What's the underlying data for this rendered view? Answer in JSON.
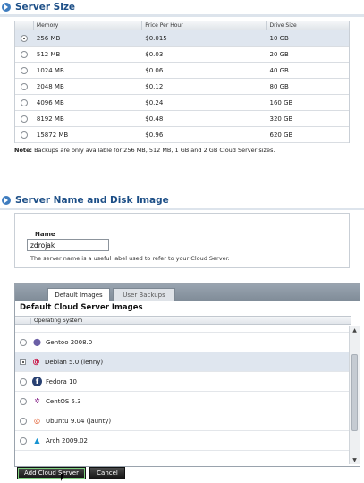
{
  "server_size": {
    "title": "Server Size",
    "headers": {
      "memory": "Memory",
      "price": "Price Per Hour",
      "disk": "Drive Size"
    },
    "rows": [
      {
        "memory": "256 MB",
        "price": "$0.015",
        "disk": "10 GB",
        "selected": true
      },
      {
        "memory": "512 MB",
        "price": "$0.03",
        "disk": "20 GB",
        "selected": false
      },
      {
        "memory": "1024 MB",
        "price": "$0.06",
        "disk": "40 GB",
        "selected": false
      },
      {
        "memory": "2048 MB",
        "price": "$0.12",
        "disk": "80 GB",
        "selected": false
      },
      {
        "memory": "4096 MB",
        "price": "$0.24",
        "disk": "160 GB",
        "selected": false
      },
      {
        "memory": "8192 MB",
        "price": "$0.48",
        "disk": "320 GB",
        "selected": false
      },
      {
        "memory": "15872 MB",
        "price": "$0.96",
        "disk": "620 GB",
        "selected": false
      }
    ],
    "note_label": "Note:",
    "note_text": " Backups are only available for 256 MB, 512 MB, 1 GB and 2 GB Cloud Server sizes."
  },
  "name_section": {
    "title": "Server Name and Disk Image",
    "name_label": "Name",
    "name_value": "zdrojak",
    "name_help": "The server name is a useful label used to refer to your Cloud Server."
  },
  "images": {
    "tabs": {
      "default": "Default Images",
      "backups": "User Backups"
    },
    "panel_title": "Default Cloud Server Images",
    "column_header": "Operating System",
    "items": [
      {
        "label": "Gentoo 2008.0",
        "icon": "gentoo-icon",
        "selected": false
      },
      {
        "label": "Debian 5.0 (lenny)",
        "icon": "debian-icon",
        "selected": true
      },
      {
        "label": "Fedora 10",
        "icon": "fedora-icon",
        "selected": false
      },
      {
        "label": "CentOS 5.3",
        "icon": "centos-icon",
        "selected": false
      },
      {
        "label": "Ubuntu 9.04 (jaunty)",
        "icon": "ubuntu-icon",
        "selected": false
      },
      {
        "label": "Arch 2009.02",
        "icon": "arch-icon",
        "selected": false
      }
    ]
  },
  "buttons": {
    "add": "Add Cloud Server",
    "cancel": "Cancel"
  }
}
